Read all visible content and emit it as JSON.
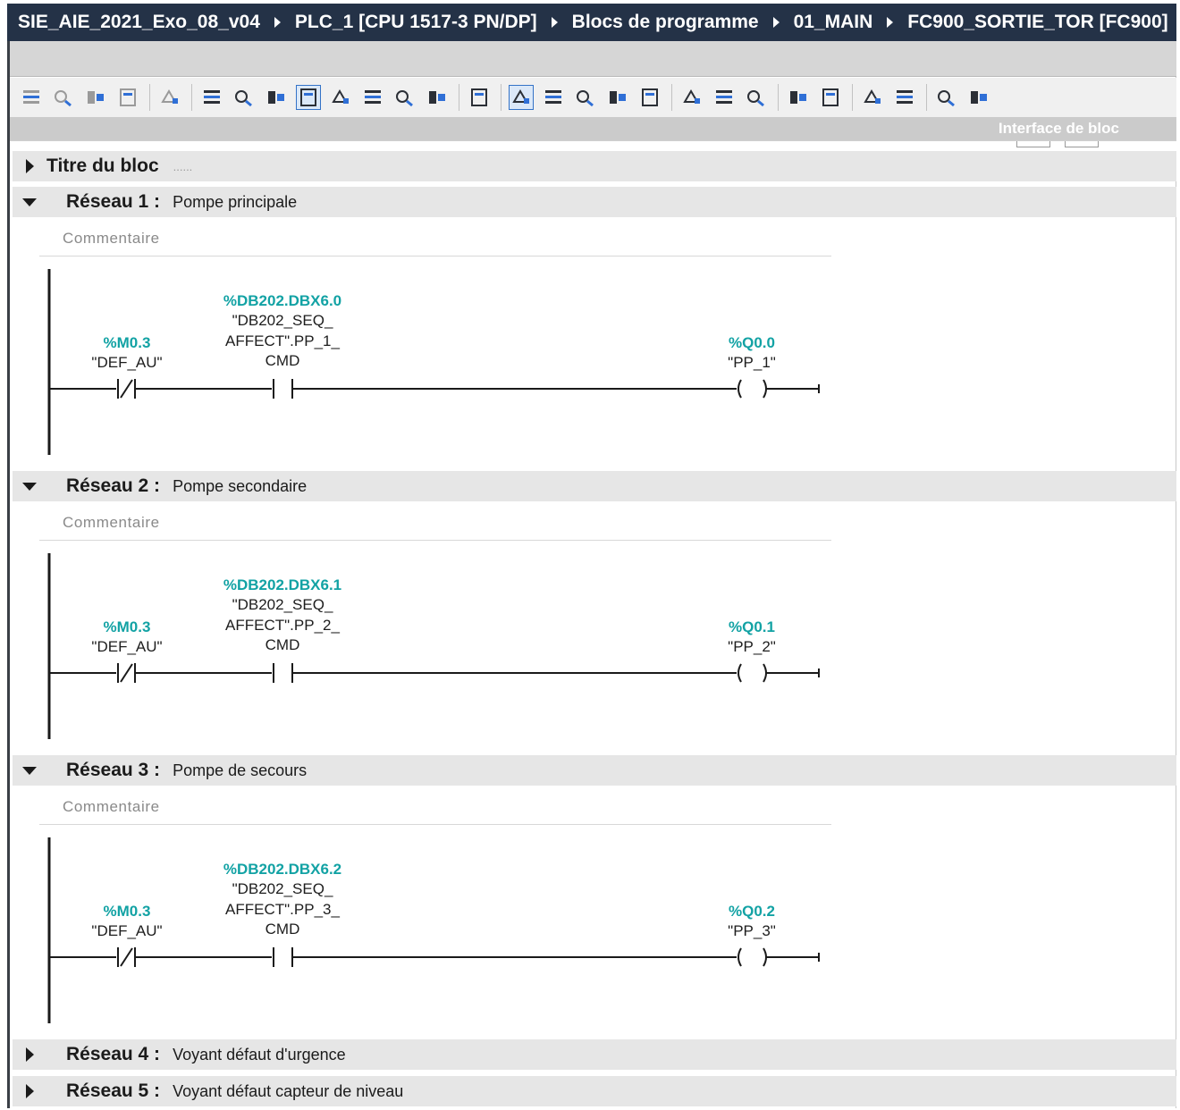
{
  "breadcrumb": {
    "items": [
      "SIE_AIE_2021_Exo_08_v04",
      "PLC_1 [CPU 1517-3 PN/DP]",
      "Blocs de programme",
      "01_MAIN",
      "FC900_SORTIE_TOR [FC900]"
    ]
  },
  "toolbar": {
    "icons": [
      "insert-network-icon",
      "delete-network-icon",
      "insert-row-icon",
      "add-row-icon",
      "reset-start-values-icon",
      "absolute-operand-icon",
      "show-favorites-icon",
      "networks-overview-icon",
      "comments-toggle-icon",
      "expand-networks-icon",
      "collapse-networks-icon",
      "operand-display-icon",
      "show-tags-icon",
      "highlight-icon",
      "jump-previous-error-icon",
      "jump-next-error-icon",
      "goto-icon",
      "update-calls-icon",
      "compare-icon",
      "monitor-icon",
      "go-back-icon",
      "mark-icon",
      "unmark-icon",
      "prev-bookmark-icon",
      "next-bookmark-icon",
      "monitoring-icon",
      "monitor-all-icon",
      "snapshot-icon"
    ],
    "pressed": [
      8,
      14
    ]
  },
  "interface": {
    "label": "Interface de bloc"
  },
  "block_title": {
    "label": "Titre du bloc",
    "dots": "......"
  },
  "networks": [
    {
      "title": "Réseau 1 :",
      "subtitle": "Pompe principale",
      "expanded": true,
      "comment": "Commentaire",
      "contact_nc": {
        "address": "%M0.3",
        "symbol": "\"DEF_AU\""
      },
      "contact_no": {
        "address": "%DB202.DBX6.0",
        "line1": "\"DB202_SEQ_",
        "line2": "AFFECT\".PP_1_",
        "line3": "CMD"
      },
      "coil": {
        "address": "%Q0.0",
        "symbol": "\"PP_1\""
      }
    },
    {
      "title": "Réseau 2 :",
      "subtitle": "Pompe secondaire",
      "expanded": true,
      "comment": "Commentaire",
      "contact_nc": {
        "address": "%M0.3",
        "symbol": "\"DEF_AU\""
      },
      "contact_no": {
        "address": "%DB202.DBX6.1",
        "line1": "\"DB202_SEQ_",
        "line2": "AFFECT\".PP_2_",
        "line3": "CMD"
      },
      "coil": {
        "address": "%Q0.1",
        "symbol": "\"PP_2\""
      }
    },
    {
      "title": "Réseau 3 :",
      "subtitle": "Pompe de secours",
      "expanded": true,
      "comment": "Commentaire",
      "contact_nc": {
        "address": "%M0.3",
        "symbol": "\"DEF_AU\""
      },
      "contact_no": {
        "address": "%DB202.DBX6.2",
        "line1": "\"DB202_SEQ_",
        "line2": "AFFECT\".PP_3_",
        "line3": "CMD"
      },
      "coil": {
        "address": "%Q0.2",
        "symbol": "\"PP_3\""
      }
    },
    {
      "title": "Réseau 4 :",
      "subtitle": "Voyant défaut d'urgence",
      "expanded": false
    },
    {
      "title": "Réseau 5 :",
      "subtitle": "Voyant défaut capteur de niveau",
      "expanded": false
    }
  ],
  "colors": {
    "breadcrumb_bg": "#243247",
    "address": "#12a2a4",
    "header_bg": "#e6e6e6"
  }
}
